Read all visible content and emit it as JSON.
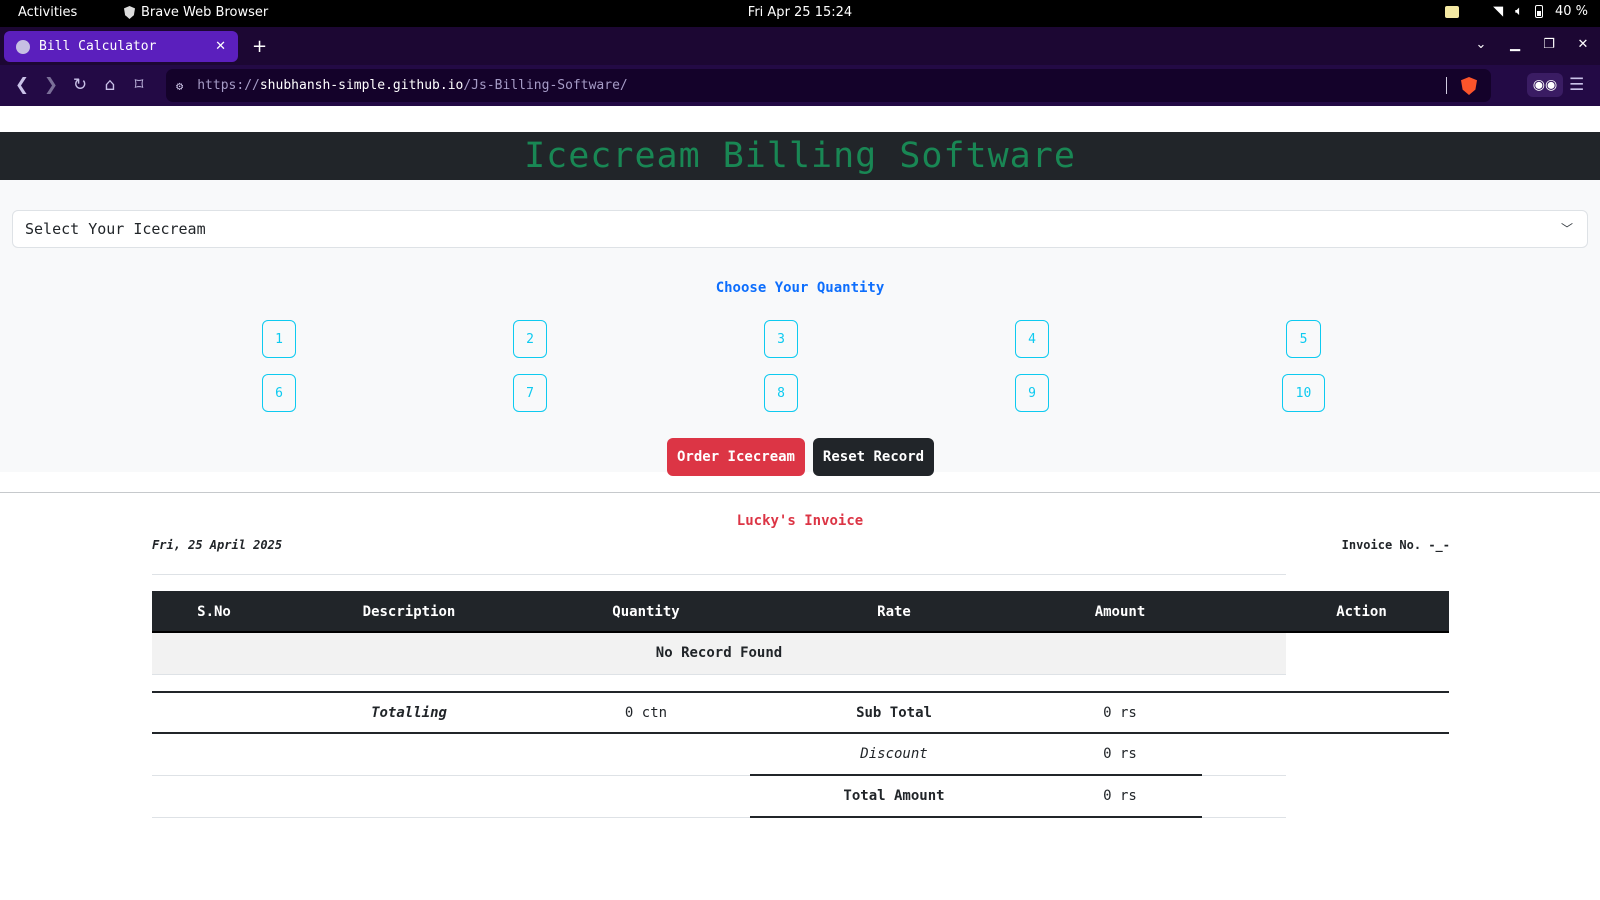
{
  "system": {
    "activities": "Activities",
    "app_name": "Brave Web Browser",
    "clock": "Fri Apr 25  15:24",
    "battery": "40 %"
  },
  "browser": {
    "tab_title": "Bill Calculator",
    "url": {
      "scheme": "https://",
      "host": "shubhansh-simple.github.io",
      "path": "/Js-Billing-Software/"
    }
  },
  "page": {
    "title": "Icecream Billing Software",
    "select_placeholder": "Select Your Icecream",
    "quantity_heading": "Choose Your Quantity",
    "quantities": [
      "1",
      "2",
      "3",
      "4",
      "5",
      "6",
      "7",
      "8",
      "9",
      "10"
    ],
    "order_button": "Order Icecream",
    "reset_button": "Reset Record"
  },
  "invoice": {
    "title": "Lucky's Invoice",
    "date": "Fri, 25 April 2025",
    "invoice_no": "Invoice No. -_-",
    "columns": [
      "S.No",
      "Description",
      "Quantity",
      "Rate",
      "Amount",
      "Action"
    ],
    "empty_message": "No Record Found",
    "totalling_label": "Totalling",
    "total_quantity": "0 ctn",
    "subtotal_label": "Sub Total",
    "subtotal_value": "0 rs",
    "discount_label": "Discount",
    "discount_value": "0 rs",
    "total_label": "Total Amount",
    "total_value": "0 rs"
  },
  "colors": {
    "title_green": "#198754",
    "banner_dark": "#212529",
    "info_cyan": "#0dcaf0",
    "primary_blue": "#0d6efd",
    "danger_red": "#dc3545",
    "browser_tab": "#5b1fbd"
  }
}
